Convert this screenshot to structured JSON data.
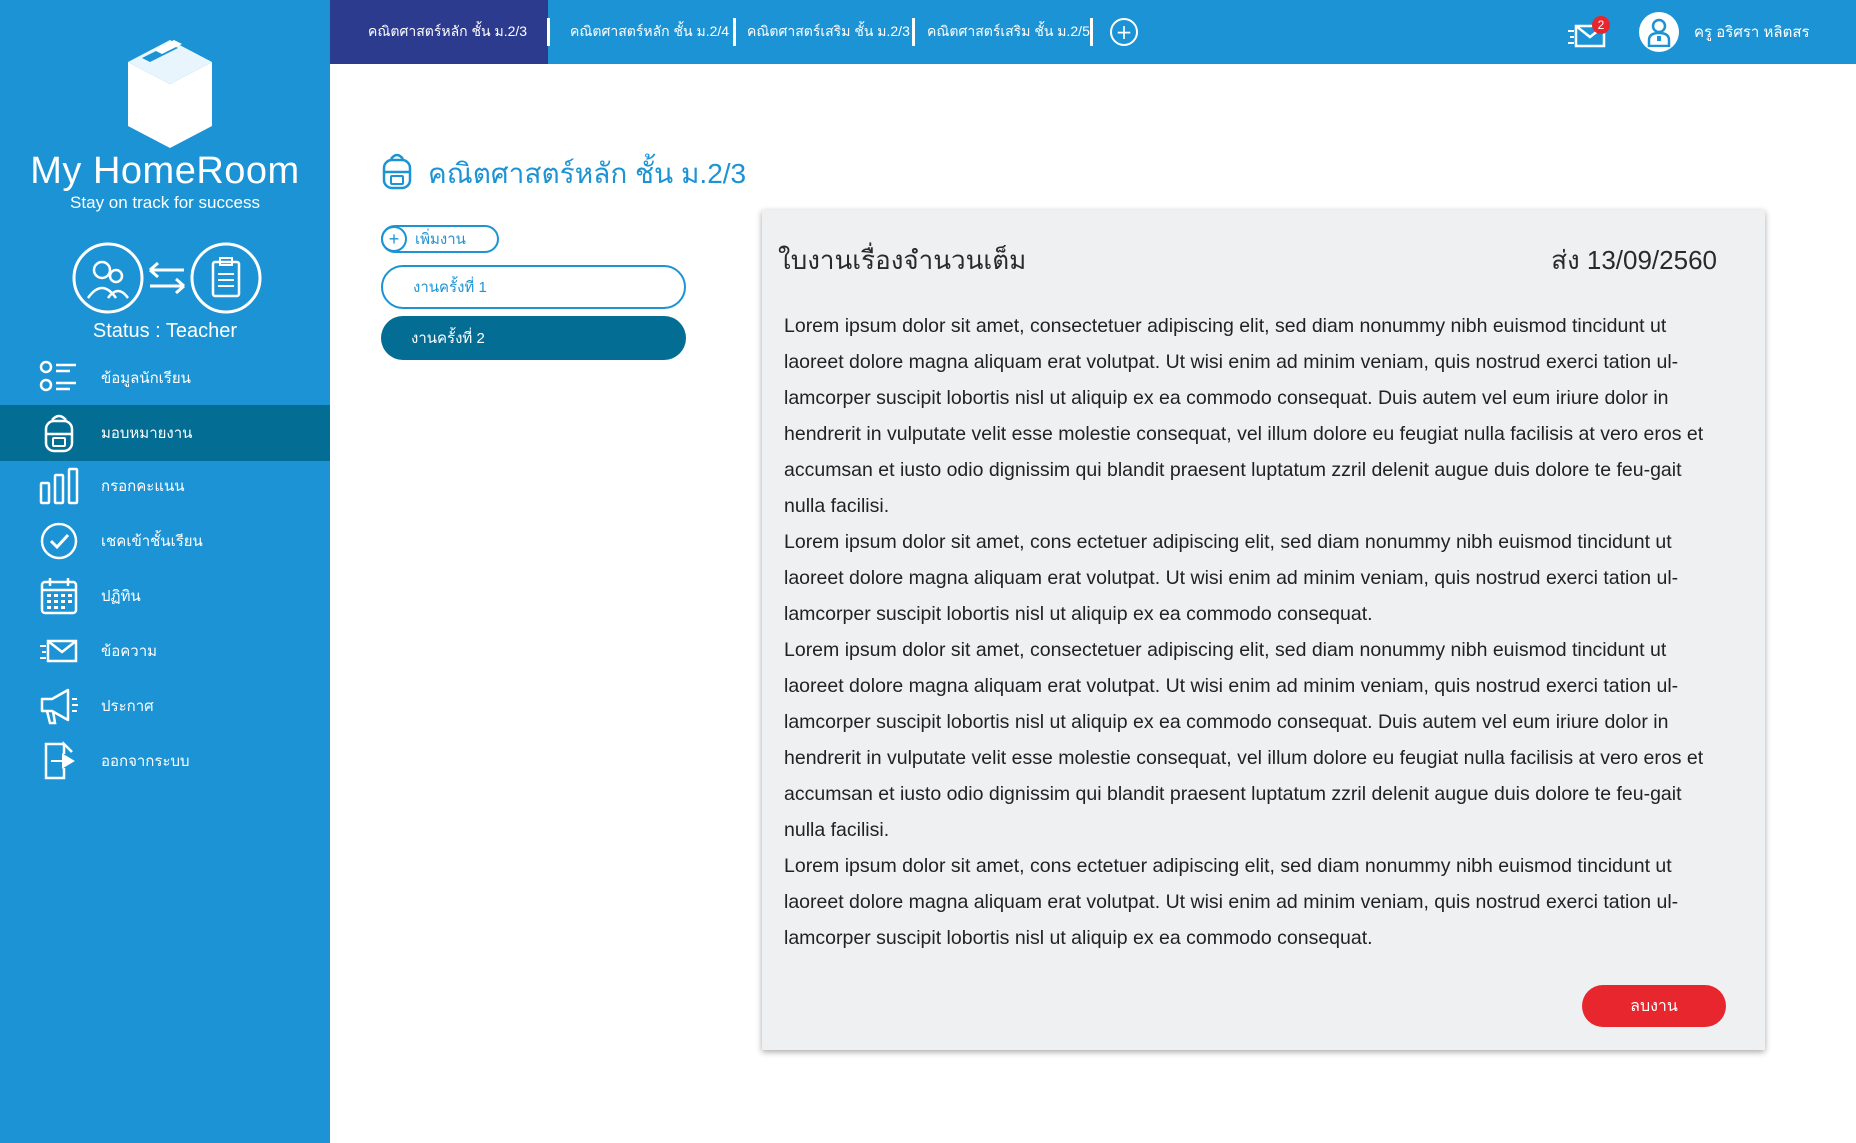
{
  "app": {
    "brand": "My HomeRoom",
    "tagline": "Stay on track for success",
    "status": "Status : Teacher",
    "colors": {
      "primary": "#1c93d4",
      "active_nav": "#046d94",
      "active_tab": "#2d3b8f",
      "danger": "#e8262d",
      "card_bg": "#eef0f1"
    }
  },
  "sidebar": {
    "items": [
      {
        "label": "ข้อมูลนักเรียน",
        "icon": "student-list-icon",
        "active": false
      },
      {
        "label": "มอบหมายงาน",
        "icon": "backpack-icon",
        "active": true
      },
      {
        "label": "กรอกคะแนน",
        "icon": "bar-chart-icon",
        "active": false
      },
      {
        "label": "เชคเข้าชั้นเรียน",
        "icon": "check-circle-icon",
        "active": false
      },
      {
        "label": "ปฏิทิน",
        "icon": "calendar-icon",
        "active": false
      },
      {
        "label": "ข้อความ",
        "icon": "mail-icon",
        "active": false
      },
      {
        "label": "ประกาศ",
        "icon": "megaphone-icon",
        "active": false
      },
      {
        "label": "ออกจากระบบ",
        "icon": "logout-icon",
        "active": false
      }
    ]
  },
  "topbar": {
    "tabs": [
      {
        "label": "คณิตศาสตร์หลัก ชั้น ม.2/3",
        "active": true
      },
      {
        "label": "คณิตศาสตร์หลัก ชั้น ม.2/4",
        "active": false
      },
      {
        "label": "คณิตศาสตร์เสริม ชั้น ม.2/3",
        "active": false
      },
      {
        "label": "คณิตศาสตร์เสริม ชั้น ม.2/5",
        "active": false
      }
    ],
    "add_tab": "+",
    "mail_badge": "2",
    "user_name": "ครู อริศรา หลิตสร"
  },
  "main": {
    "title": "คณิตศาสตร์หลัก ชั้น ม.2/3",
    "add_work_label": "เพิ่มงาน",
    "works": [
      {
        "label": "งานครั้งที่ 1",
        "selected": false
      },
      {
        "label": "งานครั้งที่ 2",
        "selected": true
      }
    ]
  },
  "card": {
    "title": "ใบงานเรื่องจำนวนเต็ม",
    "due": "ส่ง 13/09/2560",
    "paragraphs": [
      "Lorem ipsum dolor sit amet, consectetuer adipiscing elit, sed diam nonummy nibh euismod tincidunt ut laoreet dolore magna aliquam erat volutpat. Ut wisi enim ad minim veniam, quis nostrud exerci tation ul-lamcorper suscipit lobortis nisl ut aliquip ex ea commodo consequat. Duis autem vel eum iriure dolor in hendrerit in vulputate velit esse molestie consequat, vel illum dolore eu feugiat nulla facilisis at vero eros et accumsan et iusto odio dignissim qui blandit praesent luptatum zzril delenit augue duis dolore te feu-gait nulla facilisi.",
      "Lorem ipsum dolor sit amet, cons ectetuer adipiscing elit, sed diam nonummy nibh euismod tincidunt ut laoreet dolore magna aliquam erat volutpat. Ut wisi enim ad minim veniam, quis nostrud exerci tation ul-lamcorper suscipit lobortis nisl ut aliquip ex ea commodo consequat.",
      "Lorem ipsum dolor sit amet, consectetuer adipiscing elit, sed diam nonummy nibh euismod tincidunt ut laoreet dolore magna aliquam erat volutpat. Ut wisi enim ad minim veniam, quis nostrud exerci tation ul-lamcorper suscipit lobortis nisl ut aliquip ex ea commodo consequat. Duis autem vel eum iriure dolor in hendrerit in vulputate velit esse molestie consequat, vel illum dolore eu feugiat nulla facilisis at vero eros et accumsan et iusto odio dignissim qui blandit praesent luptatum zzril delenit augue duis dolore te feu-gait nulla facilisi.",
      "Lorem ipsum dolor sit amet, cons ectetuer adipiscing elit, sed diam nonummy nibh euismod tincidunt ut laoreet dolore magna aliquam erat volutpat. Ut wisi enim ad minim veniam, quis nostrud exerci tation ul-lamcorper suscipit lobortis nisl ut aliquip ex ea commodo consequat."
    ],
    "submit_label": "ลบงาน"
  }
}
